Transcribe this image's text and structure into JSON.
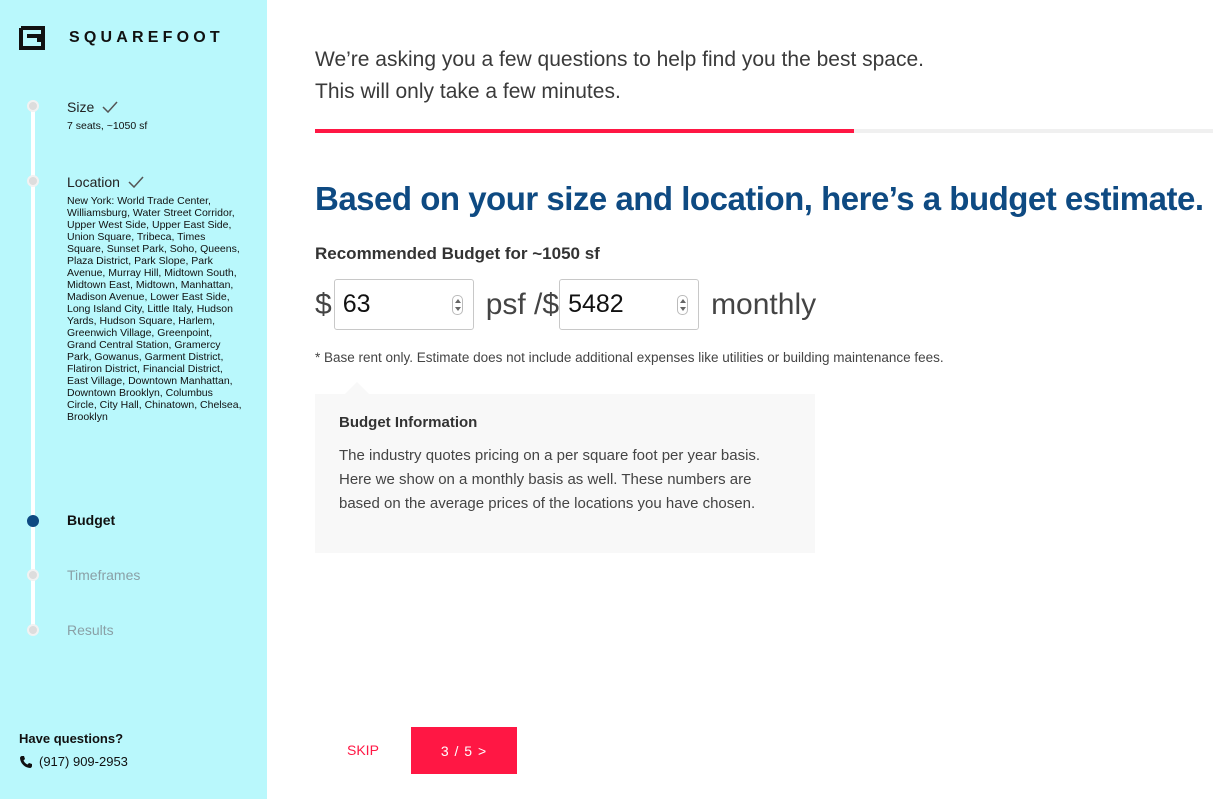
{
  "brand": {
    "logo_text": "SQUAREFOOT"
  },
  "steps": [
    {
      "title": "Size",
      "status": "done",
      "subtitle": "7 seats, ~1050 sf"
    },
    {
      "title": "Location",
      "status": "done",
      "subtitle": "New York: World Trade Center, Williamsburg, Water Street Corridor, Upper West Side, Upper East Side, Union Square, Tribeca, Times Square, Sunset Park, Soho, Queens, Plaza District, Park Slope, Park Avenue, Murray Hill, Midtown South, Midtown East, Midtown, Manhattan, Madison Avenue, Lower East Side, Long Island City, Little Italy, Hudson Yards, Hudson Square, Harlem, Greenwich Village, Greenpoint, Grand Central Station, Gramercy Park, Gowanus, Garment District, Flatiron District, Financial District, East Village, Downtown Manhattan, Downtown Brooklyn, Columbus Circle, City Hall, Chinatown, Chelsea, Brooklyn"
    },
    {
      "title": "Budget",
      "status": "active"
    },
    {
      "title": "Timeframes",
      "status": "upcoming"
    },
    {
      "title": "Results",
      "status": "upcoming"
    }
  ],
  "contact": {
    "title": "Have questions?",
    "phone": "(917) 909-2953"
  },
  "intro": {
    "line1": "We’re asking you a few questions to help find you the best space.",
    "line2": "This will only take a few minutes."
  },
  "progress": {
    "fraction": 0.6
  },
  "main": {
    "headline": "Based on your size and location, here’s a budget estimate.",
    "rec_label": "Recommended Budget for ~1050 sf",
    "currency1": "$",
    "psf_value": "63",
    "psf_unit": "psf /$",
    "monthly_value": "5482",
    "monthly_unit": "monthly",
    "footnote": "* Base rent only. Estimate does not include additional expenses like utilities or building maintenance fees."
  },
  "info": {
    "title": "Budget Information",
    "body": "The industry quotes pricing on a per square foot per year basis. Here we show on a monthly basis as well. These numbers are based on the average prices of the locations you have chosen."
  },
  "footer": {
    "skip_label": "SKIP",
    "next_label": "3 / 5 >"
  },
  "colors": {
    "accent": "#ff1744",
    "headline": "#0e4a82",
    "sidebar": "#b9f8fc"
  }
}
